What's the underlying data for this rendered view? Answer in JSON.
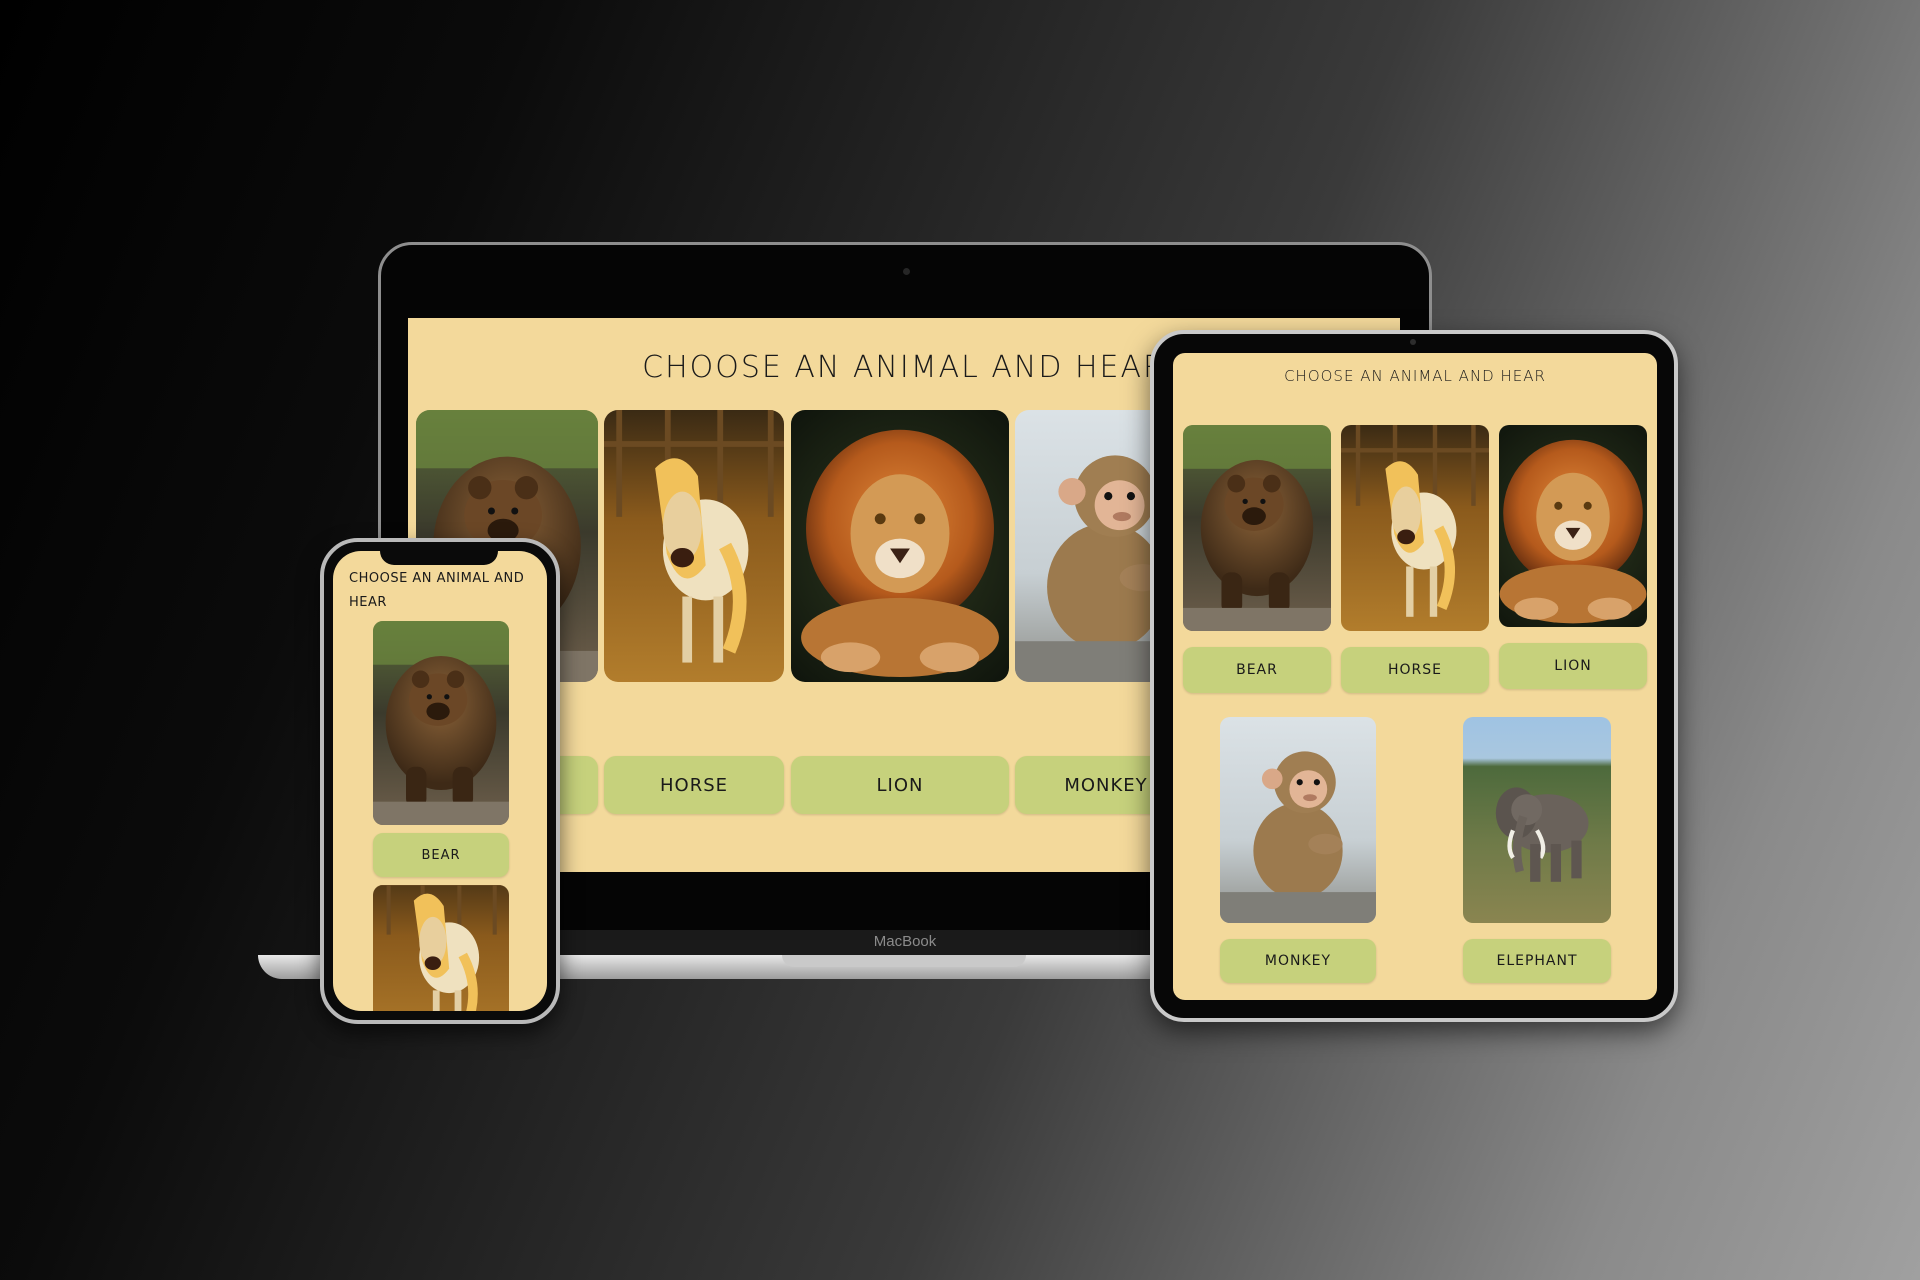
{
  "app": {
    "title": "Choose An Animal And Hear",
    "colors": {
      "background": "#f3d99b",
      "button": "#c6d17c",
      "text": "#1a1a1a"
    }
  },
  "laptop": {
    "brand": "MacBook",
    "title": "Choose An Animal And Hear",
    "animals": [
      {
        "name": "bear",
        "label": ""
      },
      {
        "name": "horse",
        "label": "Horse"
      },
      {
        "name": "lion",
        "label": "Lion"
      },
      {
        "name": "monkey",
        "label": "Monkey"
      }
    ]
  },
  "tablet": {
    "title": "Choose An Animal And Hear",
    "animals": [
      {
        "name": "bear",
        "label": "Bear"
      },
      {
        "name": "horse",
        "label": "Horse"
      },
      {
        "name": "lion",
        "label": "Lion"
      },
      {
        "name": "monkey",
        "label": "Monkey"
      },
      {
        "name": "elephant",
        "label": "Elephant"
      }
    ]
  },
  "phone": {
    "title_line1": "Choose An Animal And",
    "title_line2": "Hear",
    "animals": [
      {
        "name": "bear",
        "label": "Bear"
      },
      {
        "name": "horse",
        "label": ""
      }
    ]
  }
}
